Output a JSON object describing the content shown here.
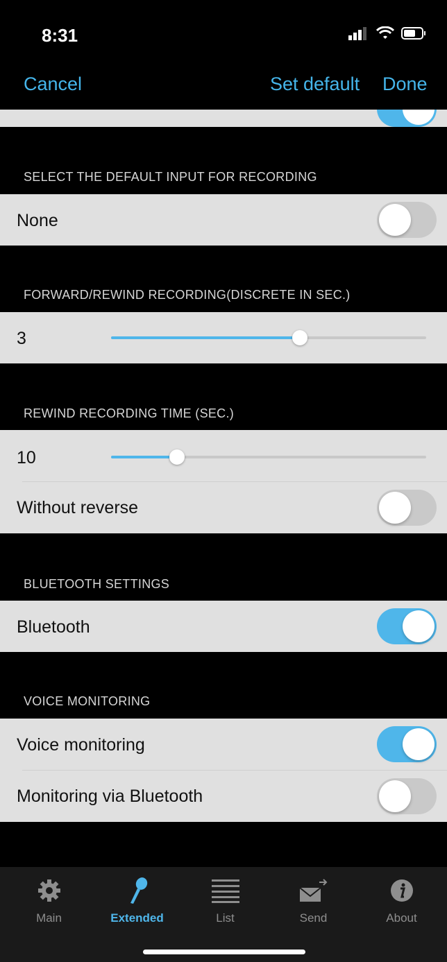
{
  "status": {
    "time": "8:31"
  },
  "nav": {
    "cancel": "Cancel",
    "set_default": "Set default",
    "done": "Done"
  },
  "sections": {
    "input": {
      "header": "SELECT THE DEFAULT INPUT FOR RECORDING",
      "row_label": "None",
      "toggle_on": false
    },
    "forward_rewind": {
      "header": "FORWARD/REWIND RECORDING(DISCRETE IN SEC.)",
      "value": "3",
      "slider_fraction": 0.6
    },
    "rewind_time": {
      "header": "REWIND RECORDING TIME (SEC.)",
      "value": "10",
      "slider_fraction": 0.21,
      "without_reverse_label": "Without reverse",
      "without_reverse_on": false
    },
    "bluetooth": {
      "header": "BLUETOOTH SETTINGS",
      "row_label": "Bluetooth",
      "toggle_on": true
    },
    "voice": {
      "header": "VOICE MONITORING",
      "voice_label": "Voice monitoring",
      "voice_on": true,
      "bt_label": "Monitoring via Bluetooth",
      "bt_on": false
    }
  },
  "tabs": [
    {
      "label": "Main",
      "icon": "gear-icon"
    },
    {
      "label": "Extended",
      "icon": "microphone-icon",
      "active": true
    },
    {
      "label": "List",
      "icon": "list-icon"
    },
    {
      "label": "Send",
      "icon": "send-envelope-icon"
    },
    {
      "label": "About",
      "icon": "info-icon"
    }
  ],
  "colors": {
    "accent": "#4fb6ea",
    "toggle_off": "#c9c9c9",
    "row_bg": "#e0e0e0",
    "tab_inactive": "#8e8e8e"
  }
}
